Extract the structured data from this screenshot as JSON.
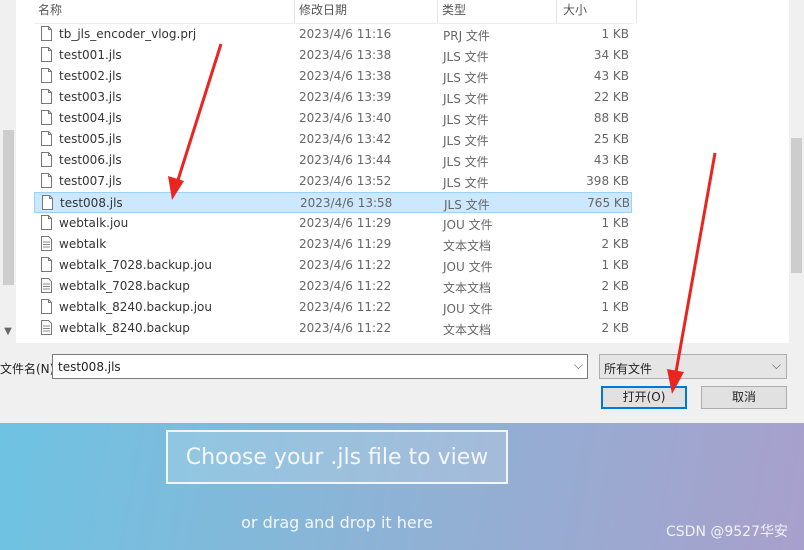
{
  "columns": {
    "name": "名称",
    "date": "修改日期",
    "type": "类型",
    "size": "大小"
  },
  "files": [
    {
      "name": "tb_jls_encoder_vlog.prj",
      "date": "2023/4/6 11:16",
      "type": "PRJ 文件",
      "size": "1 KB",
      "icon": "file-icon"
    },
    {
      "name": "test001.jls",
      "date": "2023/4/6 13:38",
      "type": "JLS 文件",
      "size": "34 KB",
      "icon": "file-icon"
    },
    {
      "name": "test002.jls",
      "date": "2023/4/6 13:38",
      "type": "JLS 文件",
      "size": "43 KB",
      "icon": "file-icon"
    },
    {
      "name": "test003.jls",
      "date": "2023/4/6 13:39",
      "type": "JLS 文件",
      "size": "22 KB",
      "icon": "file-icon"
    },
    {
      "name": "test004.jls",
      "date": "2023/4/6 13:40",
      "type": "JLS 文件",
      "size": "88 KB",
      "icon": "file-icon"
    },
    {
      "name": "test005.jls",
      "date": "2023/4/6 13:42",
      "type": "JLS 文件",
      "size": "25 KB",
      "icon": "file-icon"
    },
    {
      "name": "test006.jls",
      "date": "2023/4/6 13:44",
      "type": "JLS 文件",
      "size": "43 KB",
      "icon": "file-icon"
    },
    {
      "name": "test007.jls",
      "date": "2023/4/6 13:52",
      "type": "JLS 文件",
      "size": "398 KB",
      "icon": "file-icon"
    },
    {
      "name": "test008.jls",
      "date": "2023/4/6 13:58",
      "type": "JLS 文件",
      "size": "765 KB",
      "icon": "file-icon",
      "selected": true
    },
    {
      "name": "webtalk.jou",
      "date": "2023/4/6 11:29",
      "type": "JOU 文件",
      "size": "1 KB",
      "icon": "file-icon"
    },
    {
      "name": "webtalk",
      "date": "2023/4/6 11:29",
      "type": "文本文档",
      "size": "2 KB",
      "icon": "text-file-icon"
    },
    {
      "name": "webtalk_7028.backup.jou",
      "date": "2023/4/6 11:22",
      "type": "JOU 文件",
      "size": "1 KB",
      "icon": "file-icon"
    },
    {
      "name": "webtalk_7028.backup",
      "date": "2023/4/6 11:22",
      "type": "文本文档",
      "size": "2 KB",
      "icon": "text-file-icon"
    },
    {
      "name": "webtalk_8240.backup.jou",
      "date": "2023/4/6 11:22",
      "type": "JOU 文件",
      "size": "1 KB",
      "icon": "file-icon"
    },
    {
      "name": "webtalk_8240.backup",
      "date": "2023/4/6 11:22",
      "type": "文本文档",
      "size": "2 KB",
      "icon": "text-file-icon"
    }
  ],
  "footer": {
    "filename_label": "文件名(N):",
    "filename_value": "test008.jls",
    "filter_value": "所有文件",
    "open_label": "打开(O)",
    "cancel_label": "取消"
  },
  "webpage": {
    "choose_button": "Choose your .jls file to view",
    "drag_text": "or drag and drop it here",
    "watermark": "CSDN @9527华安"
  },
  "colors": {
    "selection": "#cce8ff",
    "annotation_arrow": "#e8261f",
    "primary_border": "#0078d7"
  }
}
